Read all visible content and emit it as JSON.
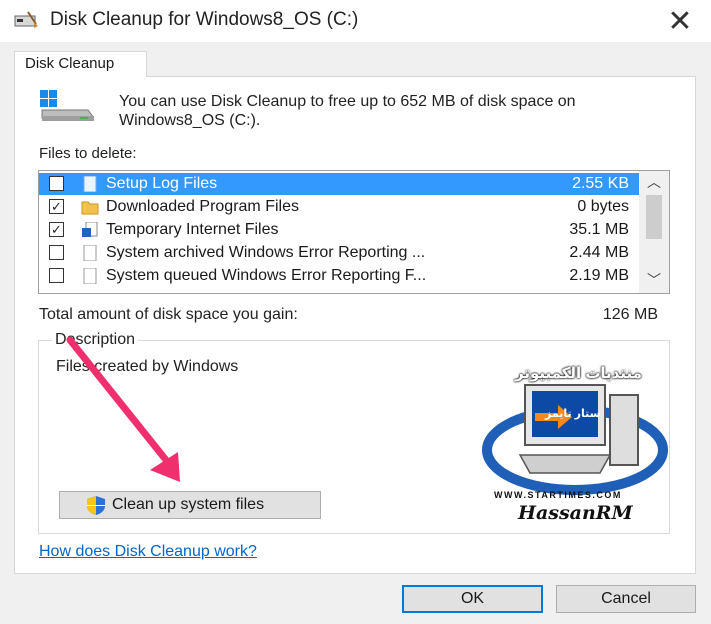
{
  "window": {
    "title": "Disk Cleanup for Windows8_OS (C:)"
  },
  "tab": {
    "label": "Disk Cleanup"
  },
  "intro": {
    "text": "You can use Disk Cleanup to free up to 652 MB of disk space on Windows8_OS (C:)."
  },
  "files": {
    "label": "Files to delete:",
    "items": [
      {
        "name": "Setup Log Files",
        "size": "2.55 KB",
        "checked": false,
        "selected": true,
        "icon": "page-icon"
      },
      {
        "name": "Downloaded Program Files",
        "size": "0 bytes",
        "checked": true,
        "selected": false,
        "icon": "folder-icon"
      },
      {
        "name": "Temporary Internet Files",
        "size": "35.1 MB",
        "checked": true,
        "selected": false,
        "icon": "lock-page-icon"
      },
      {
        "name": "System archived Windows Error Reporting ...",
        "size": "2.44 MB",
        "checked": false,
        "selected": false,
        "icon": "page-icon"
      },
      {
        "name": "System queued Windows Error Reporting F...",
        "size": "2.19 MB",
        "checked": false,
        "selected": false,
        "icon": "page-icon"
      }
    ]
  },
  "total": {
    "label": "Total amount of disk space you gain:",
    "value": "126 MB"
  },
  "description": {
    "legend": "Description",
    "text": "Files created by Windows"
  },
  "buttons": {
    "cleanup_system": "Clean up system files",
    "ok": "OK",
    "cancel": "Cancel"
  },
  "help_link": "How does Disk Cleanup work?",
  "watermark": {
    "arabic": "منتديات الكمبيوتر",
    "screen_text": "ستار تايمز",
    "url": "WWW.STARTIMES.COM",
    "signature": "HassanRM"
  },
  "colors": {
    "selection": "#3399ff",
    "link": "#0066cc",
    "arrow": "#f0306e",
    "accent": "#0078d7"
  }
}
